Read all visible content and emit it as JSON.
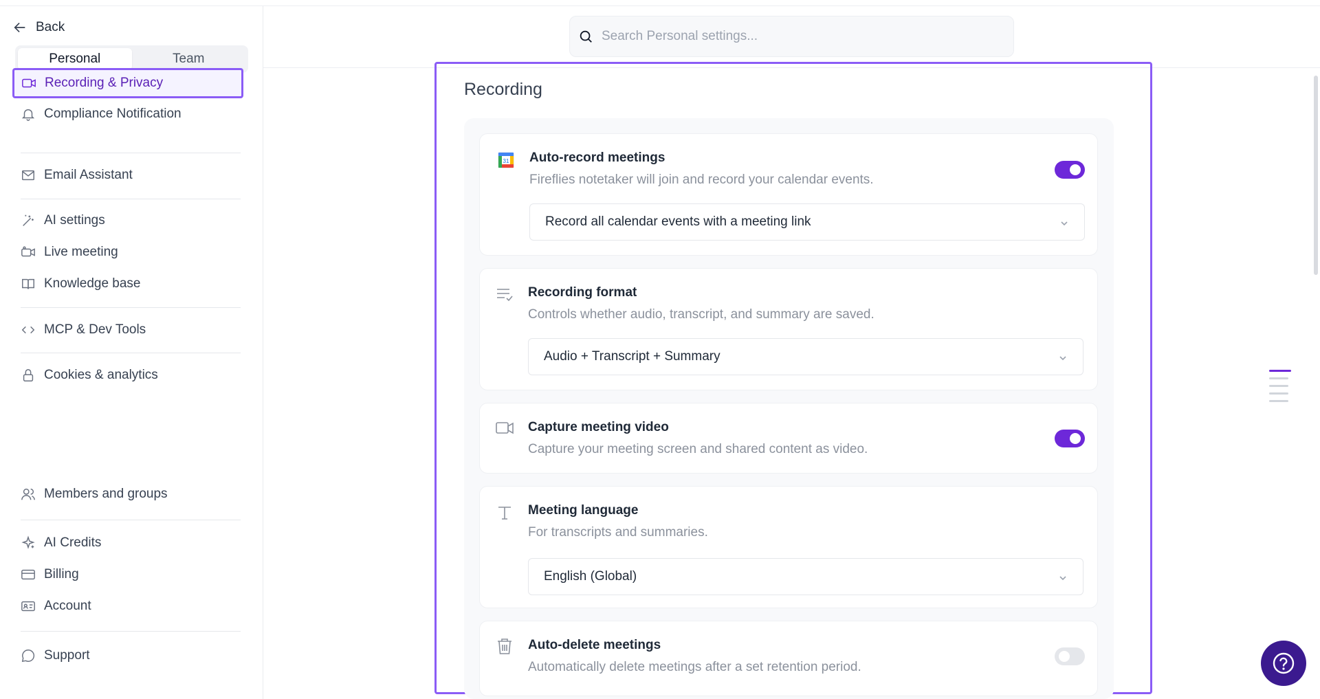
{
  "sidebar": {
    "back_label": "Back",
    "tabs": [
      {
        "label": "Personal",
        "active": true
      },
      {
        "label": "Team",
        "active": false
      }
    ],
    "items": [
      {
        "label": "Recording & Privacy",
        "icon": "video-icon",
        "active": true
      },
      {
        "label": "Compliance Notification",
        "icon": "bell-icon"
      },
      {
        "label": "Email Assistant",
        "icon": "mail-icon"
      },
      {
        "label": "AI settings",
        "icon": "magic-wand-icon"
      },
      {
        "label": "Live meeting",
        "icon": "live-video-icon"
      },
      {
        "label": "Knowledge base",
        "icon": "book-icon"
      },
      {
        "label": "MCP & Dev Tools",
        "icon": "code-icon"
      },
      {
        "label": "Cookies & analytics",
        "icon": "lock-icon"
      },
      {
        "label": "Members and groups",
        "icon": "users-icon"
      },
      {
        "label": "AI Credits",
        "icon": "sparkle-icon"
      },
      {
        "label": "Billing",
        "icon": "credit-card-icon"
      },
      {
        "label": "Account",
        "icon": "id-card-icon"
      },
      {
        "label": "Support",
        "icon": "chat-bubble-icon"
      }
    ]
  },
  "search": {
    "placeholder": "Search Personal settings..."
  },
  "main": {
    "section_title": "Recording",
    "settings": [
      {
        "title": "Auto-record meetings",
        "description": "Fireflies notetaker will join and record your calendar events.",
        "icon": "google-calendar-icon",
        "toggle": true,
        "select": "Record all calendar events with a meeting link"
      },
      {
        "title": "Recording format",
        "description": "Controls whether audio, transcript, and summary are saved.",
        "icon": "list-check-icon",
        "select": "Audio + Transcript + Summary"
      },
      {
        "title": "Capture meeting video",
        "description": "Capture your meeting screen and shared content as video.",
        "icon": "video-icon",
        "toggle": true
      },
      {
        "title": "Meeting language",
        "description": "For transcripts and summaries.",
        "icon": "text-icon",
        "select": "English (Global)"
      },
      {
        "title": "Auto-delete meetings",
        "description": "Automatically delete meetings after a set retention period.",
        "icon": "trash-icon",
        "toggle": false
      }
    ]
  },
  "colors": {
    "accent": "#6d28d9",
    "highlight_border": "#8b5cf6",
    "help_button": "#3b1a8f"
  }
}
